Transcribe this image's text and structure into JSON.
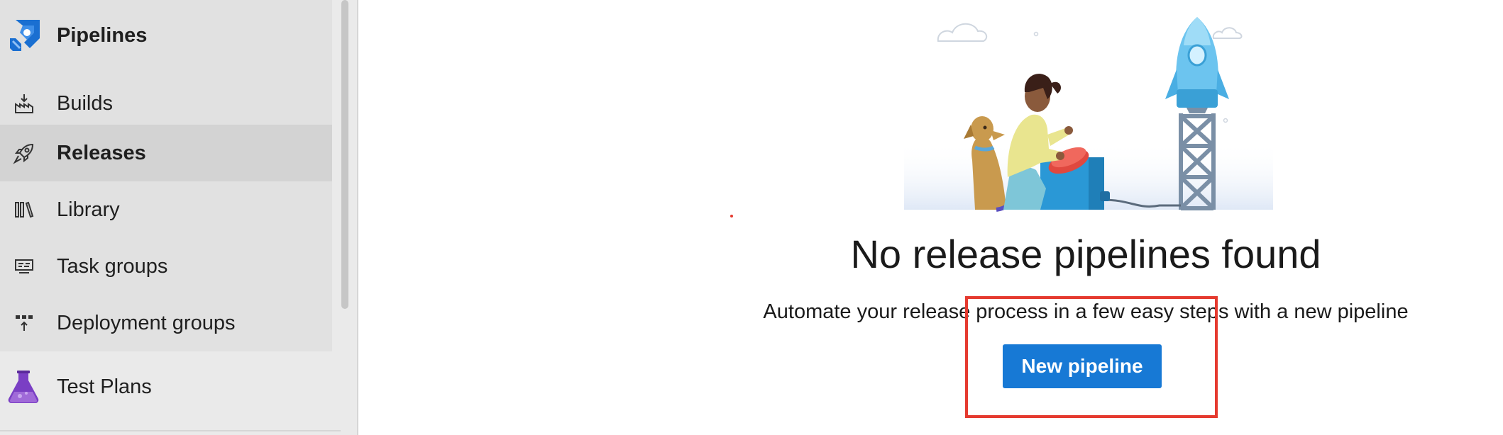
{
  "sidebar": {
    "section": {
      "label": "Pipelines",
      "icon": "pipelines-icon"
    },
    "items": [
      {
        "label": "Builds",
        "icon": "builds-icon"
      },
      {
        "label": "Releases",
        "icon": "rocket-icon",
        "selected": true
      },
      {
        "label": "Library",
        "icon": "library-icon"
      },
      {
        "label": "Task groups",
        "icon": "task-groups-icon"
      },
      {
        "label": "Deployment groups",
        "icon": "deployment-groups-icon"
      }
    ],
    "next_section": {
      "label": "Test Plans",
      "icon": "test-plans-icon"
    }
  },
  "empty_state": {
    "title": "No release pipelines found",
    "description": "Automate your release process in a few easy steps with a new pipeline",
    "button_label": "New pipeline"
  },
  "colors": {
    "accent": "#1779d5",
    "highlight": "#e53a2f",
    "sidebar_bg": "#eaeaea",
    "selected_bg": "#d3d3d3"
  }
}
